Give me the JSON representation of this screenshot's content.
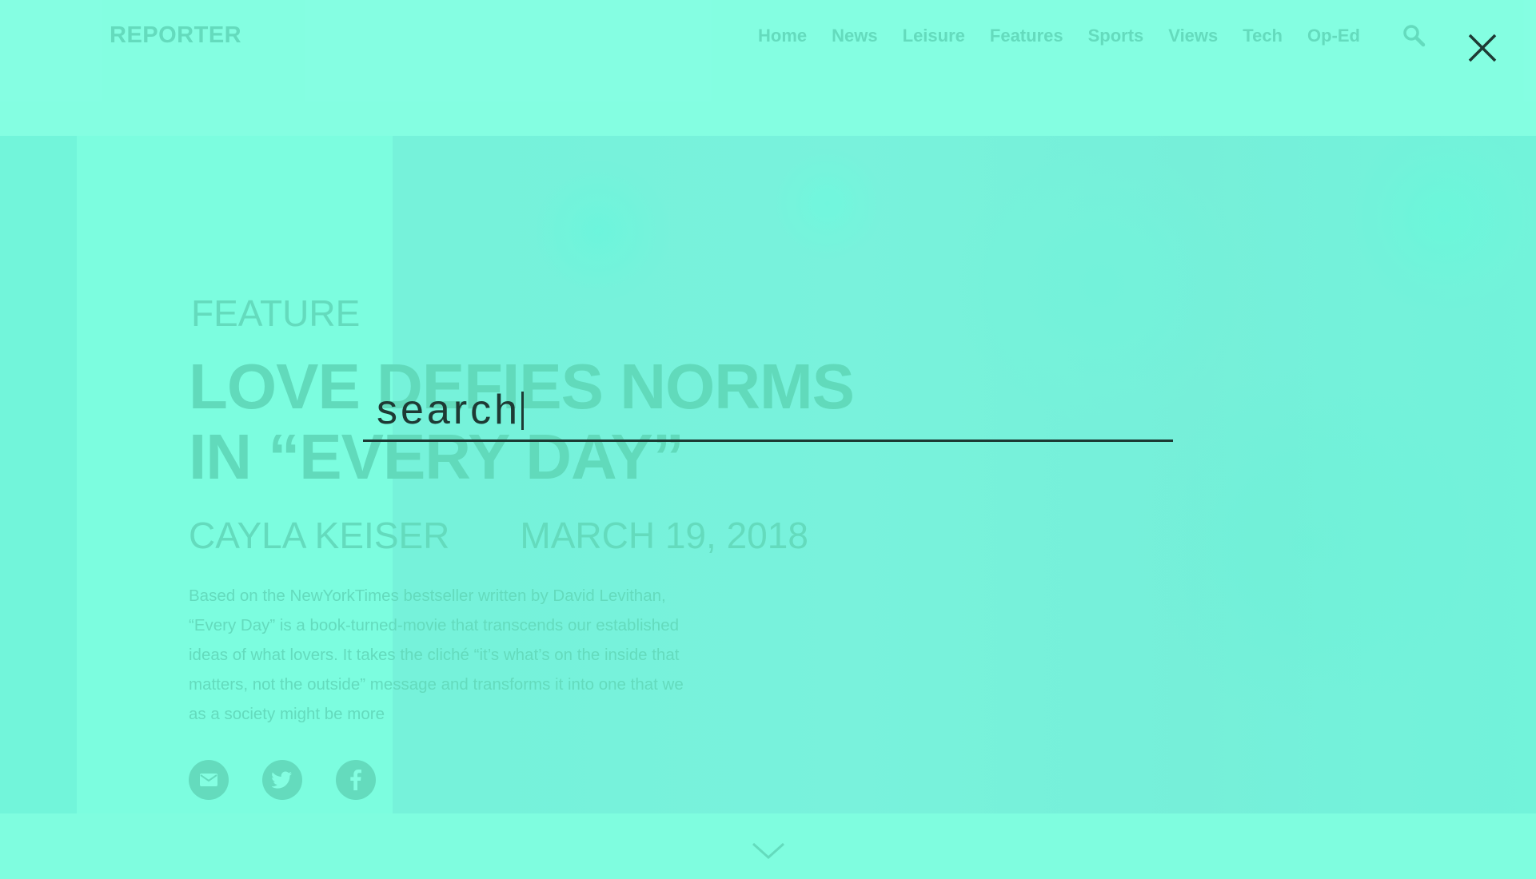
{
  "header": {
    "logo": "REPORTER",
    "nav": [
      "Home",
      "News",
      "Leisure",
      "Features",
      "Sports",
      "Views",
      "Tech",
      "Op-Ed"
    ]
  },
  "article": {
    "section": "FEATURE",
    "headline_line1": "LOVE DEFIES NORMS",
    "headline_line2": "IN “EVERY DAY”",
    "author": "CAYLA KEISER",
    "date": "MARCH 19, 2018",
    "summary": "Based on the NewYorkTimes bestseller written by David Levithan, “Every Day” is a book-turned-movie that transcends our established ideas of what lovers. It takes the cliché “it’s what’s on the inside that matters, not the outside” message and transforms it into one that we as a society might be more"
  },
  "search_overlay": {
    "value": "",
    "placeholder": "search"
  },
  "icons": {
    "close": "close-icon",
    "search": "search-icon",
    "email": "email-icon",
    "twitter": "twitter-icon",
    "facebook": "facebook-icon",
    "scroll": "chevron-down-icon"
  },
  "colors": {
    "background": "#7ffde0",
    "text_faded": "#5ed3b6",
    "text_dark": "#1e3a34"
  }
}
